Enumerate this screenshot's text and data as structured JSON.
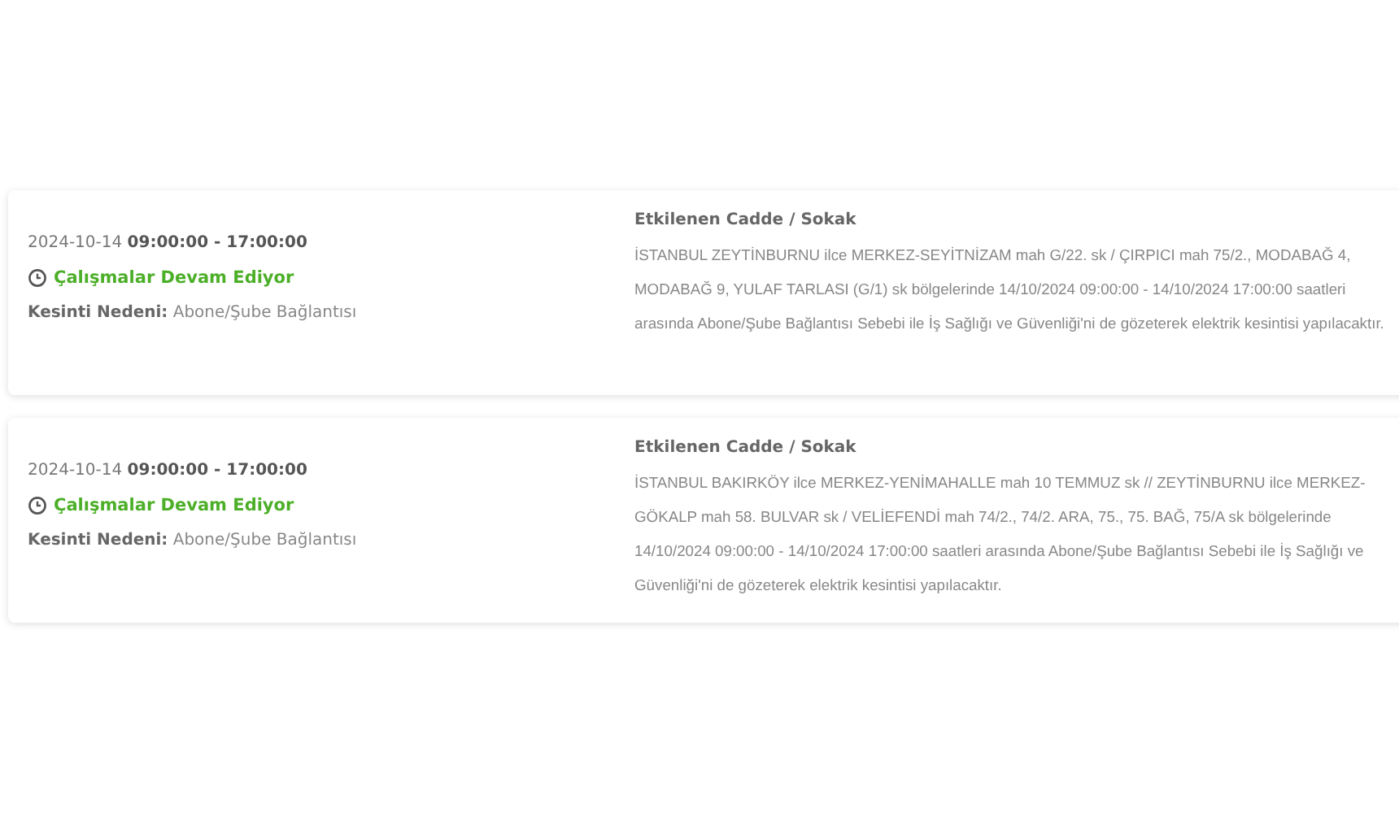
{
  "outages": [
    {
      "date": "2024-10-14 **09:00:00 - 17:00:00**",
      "status": "Çalışmalar Devam Ediyor",
      "reason": "**Kesinti Nedeni:** Abone/Şube Bağlantısı",
      "streets_heading": "Etkilenen Cadde / Sokak",
      "description": "İSTANBUL ZEYTİNBURNU ilce MERKEZ-SEYİTNİZAM mah G/22. sk / ÇIRPICI mah 75/2., MODABAĞ 4, MODABAĞ 9, YULAF TARLASI (G/1) sk bölgelerinde 14/10/2024 09:00:00 - 14/10/2024 17:00:00 saatleri arasında Abone/Şube Bağlantısı Sebebi ile İş Sağlığı ve Güvenliği'ni de gözeterek elektrik kesintisi yapılacaktır."
    },
    {
      "date": "2024-10-14 **09:00:00 - 17:00:00**",
      "status": "Çalışmalar Devam Ediyor",
      "reason": "**Kesinti Nedeni:** Abone/Şube Bağlantısı",
      "streets_heading": "Etkilenen Cadde / Sokak",
      "description": "İSTANBUL BAKIRKÖY ilce MERKEZ-YENİMAHALLE mah 10 TEMMUZ sk // ZEYTİNBURNU ilce MERKEZ-GÖKALP mah 58. BULVAR sk / VELİEFENDİ mah 74/2., 74/2. ARA, 75., 75. BAĞ, 75/A sk bölgelerinde 14/10/2024 09:00:00 - 14/10/2024 17:00:00 saatleri arasında Abone/Şube Bağlantısı Sebebi ile İş Sağlığı ve Güvenliği'ni de gözeterek elektrik kesintisi yapılacaktır."
    }
  ]
}
